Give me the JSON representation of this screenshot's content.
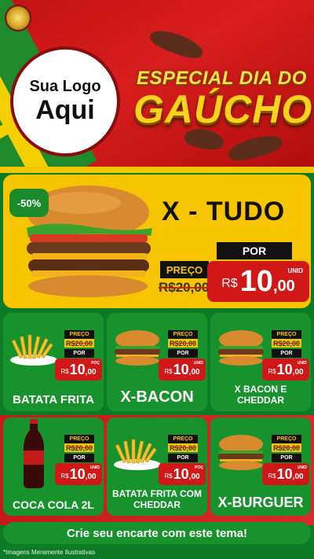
{
  "header": {
    "logo_line1": "Sua Logo",
    "logo_line2": "Aqui",
    "title_line1": "ESPECIAL DIA DO",
    "title_line2": "GAÚCHO"
  },
  "featured": {
    "discount": "-50%",
    "name": "X - TUDO",
    "preco_label": "PREÇO",
    "old_price": "R$20,00",
    "por_label": "POR",
    "currency": "R$",
    "price_int": "10",
    "price_dec": ",00",
    "unit": "UNID"
  },
  "products": [
    {
      "name": "BATATA FRITA",
      "preco_label": "PREÇO",
      "old_price": "R$20,00",
      "por_label": "POR",
      "currency": "R$",
      "price_int": "10",
      "price_dec": ",00",
      "unit": "POÇ",
      "icon": "fries-icon"
    },
    {
      "name": "X-BACON",
      "preco_label": "PREÇO",
      "old_price": "R$20,00",
      "por_label": "POR",
      "currency": "R$",
      "price_int": "10",
      "price_dec": ",00",
      "unit": "UNID",
      "icon": "burger-icon"
    },
    {
      "name": "X BACON E CHEDDAR",
      "preco_label": "PREÇO",
      "old_price": "R$20,00",
      "por_label": "POR",
      "currency": "R$",
      "price_int": "10",
      "price_dec": ",00",
      "unit": "UNID",
      "icon": "burger-icon"
    },
    {
      "name": "COCA COLA 2L",
      "preco_label": "PREÇO",
      "old_price": "R$20,00",
      "por_label": "POR",
      "currency": "R$",
      "price_int": "10",
      "price_dec": ",00",
      "unit": "UNID",
      "icon": "soda-bottle-icon"
    },
    {
      "name": "BATATA FRITA COM CHEDDAR",
      "preco_label": "PREÇO",
      "old_price": "R$20,00",
      "por_label": "POR",
      "currency": "R$",
      "price_int": "10",
      "price_dec": ",00",
      "unit": "POÇ",
      "icon": "fries-icon"
    },
    {
      "name": "X-BURGUER",
      "preco_label": "PREÇO",
      "old_price": "R$20,00",
      "por_label": "POR",
      "currency": "R$",
      "price_int": "10",
      "price_dec": ",00",
      "unit": "UNID",
      "icon": "burger-icon"
    }
  ],
  "cta": "Crie seu encarte com este tema!",
  "footnote": "*Imagens Meramente Ilustrativas",
  "colors": {
    "red": "#d01818",
    "green": "#18922c",
    "yellow": "#f6c400",
    "black": "#111111"
  }
}
